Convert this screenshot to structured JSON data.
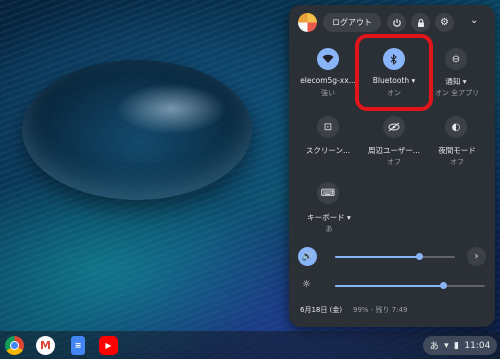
{
  "panel": {
    "logout_label": "ログアウト",
    "tiles": [
      {
        "label": "elecom5g-xx...",
        "sub": "強い",
        "icon": "wifi-icon"
      },
      {
        "label": "Bluetooth ▾",
        "sub": "オン",
        "icon": "bluetooth-icon"
      },
      {
        "label": "通知 ▾",
        "sub": "オン 全アプリ",
        "icon": "notifications-icon"
      },
      {
        "label": "スクリーン...",
        "sub": "",
        "icon": "screen-capture-icon"
      },
      {
        "label": "周辺ユーザー...",
        "sub": "オフ",
        "icon": "nearby-visibility-icon"
      },
      {
        "label": "夜間モード",
        "sub": "オフ",
        "icon": "night-light-icon"
      },
      {
        "label": "キーボード ▾",
        "sub": "あ",
        "icon": "keyboard-icon"
      }
    ],
    "volume_level": 0.7,
    "brightness_level": 0.72,
    "date": "6月18日 (金)",
    "battery": "99% - 残り 7:49"
  },
  "shelf": {
    "apps": [
      "Chrome",
      "Gmail",
      "Docs",
      "YouTube"
    ],
    "ime_indicator": "あ",
    "time": "11:04"
  },
  "colors": {
    "panel_bg": "#2b3036",
    "accent": "#8ab4f8",
    "highlight": "#e0161b"
  }
}
